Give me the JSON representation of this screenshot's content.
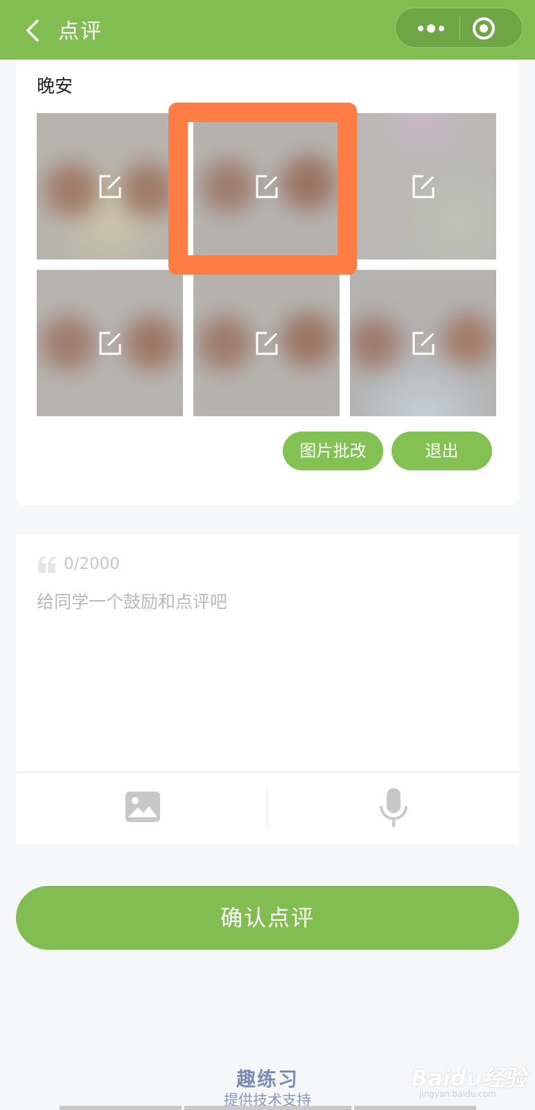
{
  "nav": {
    "title": "点评"
  },
  "post": {
    "text": "晚安"
  },
  "actions": {
    "annotate_label": "图片批改",
    "exit_label": "退出"
  },
  "comment": {
    "counter": "0/2000",
    "placeholder": "给同学一个鼓励和点评吧"
  },
  "tools": {
    "image_icon": "image-icon",
    "mic_icon": "microphone-icon"
  },
  "confirm": {
    "label": "确认点评"
  },
  "footer": {
    "brand": "趣练习",
    "support": "提供技术支持"
  },
  "watermark": {
    "logo": "Baidu经验",
    "url": "jingyan.baidu.com"
  },
  "colors": {
    "primary": "#82bd52",
    "highlight": "#ff7d45"
  }
}
